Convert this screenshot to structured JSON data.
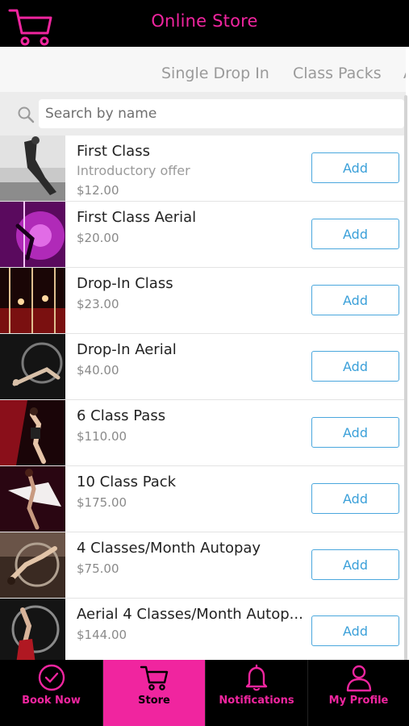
{
  "header": {
    "title": "Online Store"
  },
  "tabs": [
    {
      "label": "Single Drop In"
    },
    {
      "label": "Class Packs"
    },
    {
      "label": "A"
    }
  ],
  "search": {
    "placeholder": "Search by name"
  },
  "colors": {
    "brand": "#f0259f",
    "accent_button": "#3ba0d9",
    "background": "#000000"
  },
  "items": [
    {
      "name": "First Class",
      "subtitle": "Introductory offer",
      "price": "$12.00",
      "button": "Add",
      "image": "aerial-hoop-performer-bw"
    },
    {
      "name": "First Class Aerial",
      "price": "$20.00",
      "button": "Add",
      "image": "aerial-silks-purple-light"
    },
    {
      "name": "Drop-In Class",
      "price": "$23.00",
      "button": "Add",
      "image": "pole-studio-red"
    },
    {
      "name": "Drop-In Aerial",
      "price": "$40.00",
      "button": "Add",
      "image": "aerial-hoop-dark"
    },
    {
      "name": "6 Class Pass",
      "price": "$110.00",
      "button": "Add",
      "image": "dancer-red-drape"
    },
    {
      "name": "10 Class Pack",
      "price": "$175.00",
      "button": "Add",
      "image": "dancer-white-fabric"
    },
    {
      "name": "4 Classes/Month Autopay",
      "price": "$75.00",
      "button": "Add",
      "image": "hoop-performer-warm"
    },
    {
      "name": "Aerial 4 Classes/Month Autop...",
      "price": "$144.00",
      "button": "Add",
      "image": "hoop-performer-red"
    }
  ],
  "nav": [
    {
      "label": "Book Now",
      "icon": "check-circle-icon"
    },
    {
      "label": "Store",
      "icon": "cart-icon",
      "active": true
    },
    {
      "label": "Notifications",
      "icon": "bell-icon"
    },
    {
      "label": "My Profile",
      "icon": "user-icon"
    }
  ]
}
